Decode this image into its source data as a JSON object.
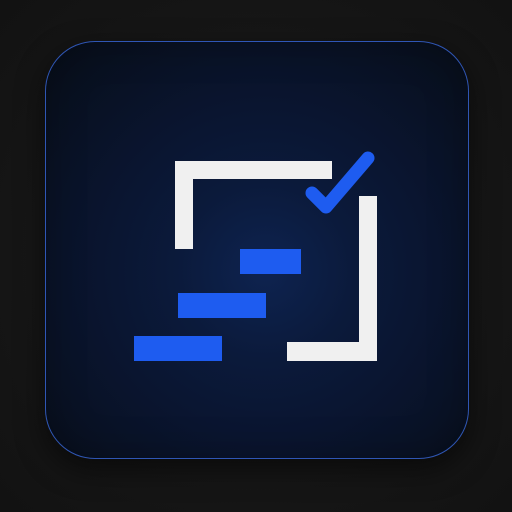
{
  "icon": {
    "symbol": "task-steps-check-icon",
    "colors": {
      "frame": "#F0F0F0",
      "accent": "#1E5CF0",
      "background_center": "#0E2350",
      "background_edge": "#070D19",
      "border": "#3C6EE6",
      "page_background": "#171717"
    }
  }
}
